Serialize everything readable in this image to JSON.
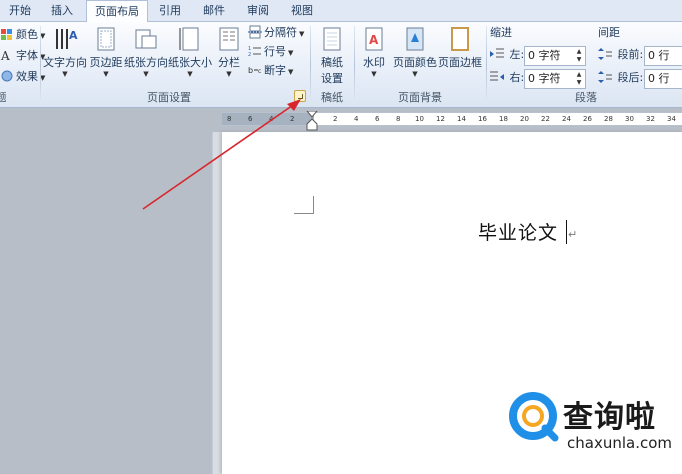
{
  "tabs": [
    {
      "label": "开始",
      "active": false
    },
    {
      "label": "插入",
      "active": false
    },
    {
      "label": "页面布局",
      "active": true
    },
    {
      "label": "引用",
      "active": false
    },
    {
      "label": "邮件",
      "active": false
    },
    {
      "label": "审阅",
      "active": false
    },
    {
      "label": "视图",
      "active": false
    }
  ],
  "ribbon": {
    "themes": {
      "colors": "颜色",
      "fonts": "字体",
      "effects": "效果",
      "group_label": "题"
    },
    "page_setup": {
      "text_direction": "文字方向",
      "margins": "页边距",
      "orientation": "纸张方向",
      "size": "纸张大小",
      "columns": "分栏",
      "breaks": "分隔符",
      "line_numbers": "行号",
      "hyphenation": "断字",
      "group_label": "页面设置"
    },
    "manuscript": {
      "settings_line1": "稿纸",
      "settings_line2": "设置",
      "group_label": "稿纸"
    },
    "page_background": {
      "watermark": "水印",
      "page_color": "页面颜色",
      "page_borders": "页面边框",
      "group_label": "页面背景"
    },
    "paragraph": {
      "indent_heading": "缩进",
      "spacing_heading": "间距",
      "left_label": "左:",
      "left_value": "0 字符",
      "right_label": "右:",
      "right_value": "0 字符",
      "before_label": "段前:",
      "before_value": "0 行",
      "after_label": "段后:",
      "after_value": "0 行",
      "group_label": "段落"
    }
  },
  "ruler": {
    "ticks": [
      "8",
      "6",
      "4",
      "2",
      "2",
      "4",
      "6",
      "8",
      "10",
      "12",
      "14",
      "16",
      "18",
      "20",
      "22",
      "24",
      "26",
      "28",
      "30",
      "32",
      "34"
    ]
  },
  "document": {
    "text": "毕业论文"
  },
  "watermark": {
    "title": "查询啦",
    "url": "chaxunla.com"
  },
  "colors": {
    "annotation_arrow": "#d9262c",
    "logo_blue": "#1f8fe8",
    "logo_orange": "#f5a623"
  }
}
